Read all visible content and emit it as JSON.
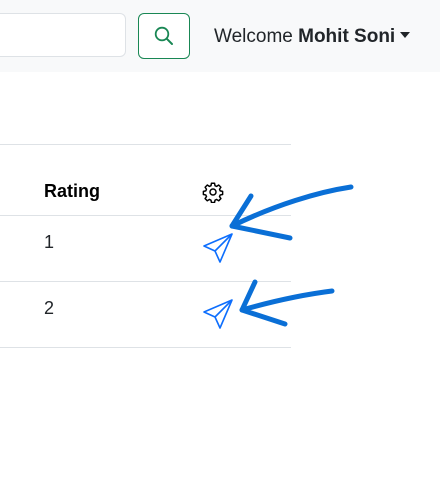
{
  "navbar": {
    "search_value": "",
    "search_icon": "search-icon",
    "welcome_text": "Welcome",
    "user_name": "Mohit Soni",
    "dropdown_icon": "caret-down-icon"
  },
  "table": {
    "headers": {
      "rating": "Rating",
      "settings_icon": "gear-icon"
    },
    "rows": [
      {
        "rating": "1",
        "action_icon": "send-icon"
      },
      {
        "rating": "2",
        "action_icon": "send-icon"
      }
    ]
  },
  "colors": {
    "navbar_bg": "#f8f9fa",
    "search_button_border": "#198754",
    "send_icon": "#0d6efd",
    "annotation_arrow": "#0a6fd6"
  }
}
